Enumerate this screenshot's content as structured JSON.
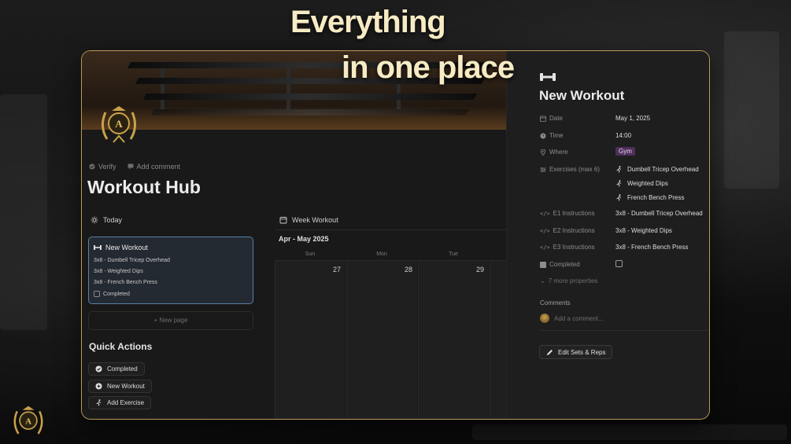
{
  "headline": {
    "line1": "Everything",
    "line2": "in one place"
  },
  "left": {
    "meta": {
      "verify": "Verify",
      "add_comment": "Add comment"
    },
    "title": "Workout Hub",
    "today": {
      "label": "Today",
      "card": {
        "title": "New Workout",
        "lines": [
          "3x8 - Dumbell Tricep Overhead",
          "3x8 - Weighted Dips",
          "3x8 - French Bench Press"
        ],
        "completed_label": "Completed"
      },
      "new_page": "+ New page"
    },
    "quick_actions": {
      "title": "Quick Actions",
      "buttons": [
        "Completed",
        "New Workout",
        "Add Exercise"
      ]
    },
    "week": {
      "label": "Week Workout",
      "range": "Apr - May 2025",
      "days": [
        {
          "dow": "Sun",
          "num": "27"
        },
        {
          "dow": "Mon",
          "num": "28"
        },
        {
          "dow": "Tue",
          "num": "29"
        }
      ]
    }
  },
  "right": {
    "title": "New Workout",
    "props": {
      "date_label": "Date",
      "date_value": "May 1, 2025",
      "time_label": "Time",
      "time_value": "14:00",
      "where_label": "Where",
      "where_value": "Gym",
      "exercises_label": "Exercises (max 6)",
      "exercises": [
        "Dumbell Tricep Overhead",
        "Weighted Dips",
        "French Bench Press"
      ],
      "e1_label": "E1 Instructions",
      "e1_value": "3x8 - Dumbell Tricep Overhead",
      "e2_label": "E2 Instructions",
      "e2_value": "3x8 - Weighted Dips",
      "e3_label": "E3 Instructions",
      "e3_value": "3x8 - French Bench Press",
      "completed_label": "Completed",
      "more_props": "7 more properties"
    },
    "comments_label": "Comments",
    "comment_placeholder": "Add a comment...",
    "edit_button": "Edit Sets & Reps"
  },
  "colors": {
    "accent_border": "#b89a5a",
    "selected_card": "#5a7fa8",
    "tag_purple": "#4e2f5a",
    "headline": "#f6ebc4"
  }
}
